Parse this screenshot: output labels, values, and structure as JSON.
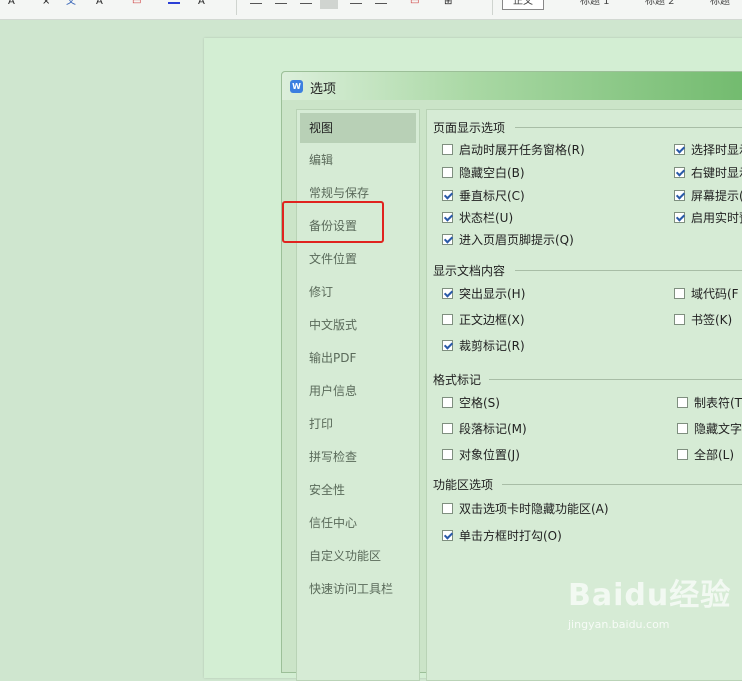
{
  "toolbar": {
    "styles": [
      "正文",
      "标题 1",
      "标题 2",
      "标题"
    ]
  },
  "dialog": {
    "title": "选项",
    "app_icon": "W"
  },
  "nav": {
    "items": [
      "视图",
      "编辑",
      "常规与保存",
      "备份设置",
      "文件位置",
      "修订",
      "中文版式",
      "输出PDF",
      "用户信息",
      "打印",
      "拼写检查",
      "安全性",
      "信任中心",
      "自定义功能区",
      "快速访问工具栏"
    ],
    "active_index": 0,
    "highlighted_index": 3
  },
  "groups": {
    "page_display": "页面显示选项",
    "show_content": "显示文档内容",
    "format_marks": "格式标记",
    "ribbon": "功能区选项"
  },
  "options": {
    "page_display_left": [
      {
        "label": "启动时展开任务窗格(R)",
        "checked": false
      },
      {
        "label": "隐藏空白(B)",
        "checked": false
      },
      {
        "label": "垂直标尺(C)",
        "checked": true
      },
      {
        "label": "状态栏(U)",
        "checked": true
      },
      {
        "label": "进入页眉页脚提示(Q)",
        "checked": true
      }
    ],
    "page_display_right": [
      {
        "label": "选择时显示",
        "checked": true
      },
      {
        "label": "右键时显示",
        "checked": true
      },
      {
        "label": "屏幕提示(",
        "checked": true
      },
      {
        "label": "启用实时预",
        "checked": true
      }
    ],
    "show_content_left": [
      {
        "label": "突出显示(H)",
        "checked": true
      },
      {
        "label": "正文边框(X)",
        "checked": false
      },
      {
        "label": "裁剪标记(R)",
        "checked": true
      }
    ],
    "show_content_right": [
      {
        "label": "域代码(F",
        "checked": false
      },
      {
        "label": "书签(K)",
        "checked": false
      }
    ],
    "format_left": [
      {
        "label": "空格(S)",
        "checked": false
      },
      {
        "label": "段落标记(M)",
        "checked": false
      },
      {
        "label": "对象位置(J)",
        "checked": false
      }
    ],
    "format_right": [
      {
        "label": "制表符(T)",
        "checked": false
      },
      {
        "label": "隐藏文字(",
        "checked": false
      },
      {
        "label": "全部(L)",
        "checked": false
      }
    ],
    "ribbon": [
      {
        "label": "双击选项卡时隐藏功能区(A)",
        "checked": false
      },
      {
        "label": "单击方框时打勾(O)",
        "checked": true
      }
    ]
  },
  "watermark": {
    "text": "Baidu经验",
    "sub": "jingyan.baidu.com"
  }
}
